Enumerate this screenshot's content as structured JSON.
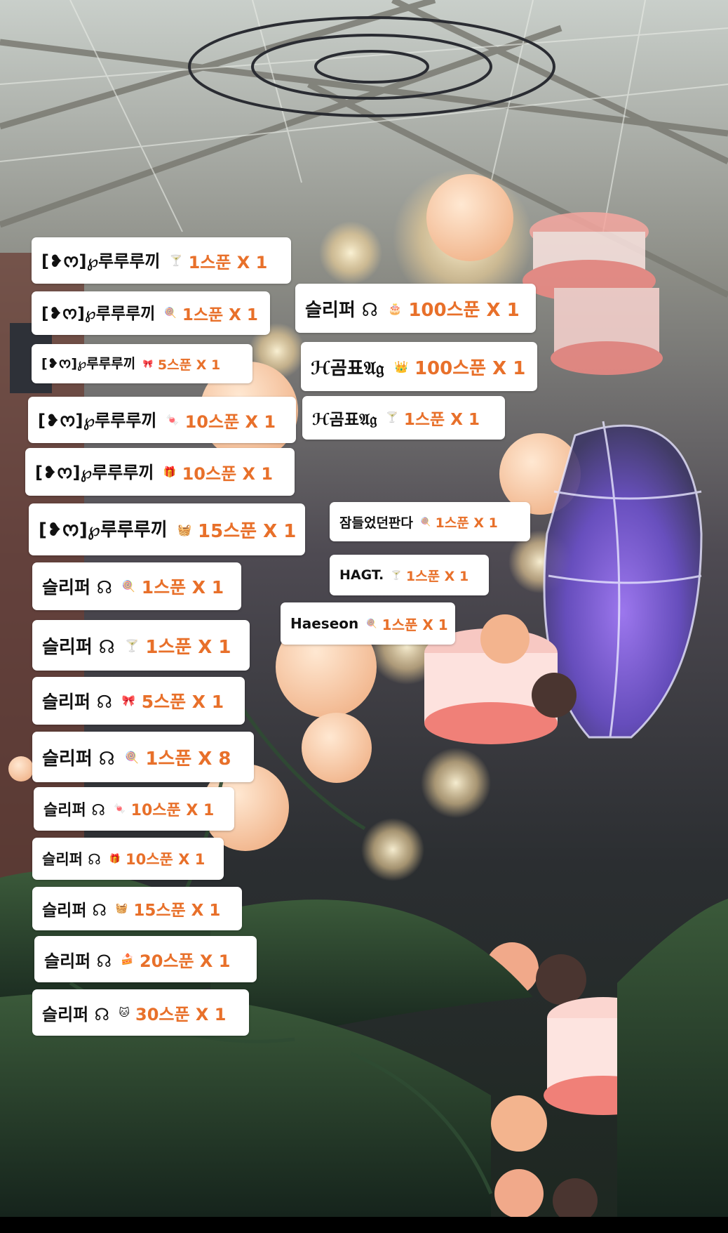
{
  "colors": {
    "amount": "#e8702a",
    "sticker_bg": "#ffffff",
    "name": "#111111"
  },
  "donations": [
    {
      "name": "[❥ᰔ]℘루루루끼",
      "icon": "🍸",
      "amount": "1스푼 X 1"
    },
    {
      "name": "[❥ᰔ]℘루루루끼",
      "icon": "🍭",
      "amount": "1스푼 X 1"
    },
    {
      "name": "[❥ᰔ]℘루루루끼",
      "icon": "🎀",
      "amount": "5스푼 X 1"
    },
    {
      "name": "[❥ᰔ]℘루루루끼",
      "icon": "🍬",
      "amount": "10스푼 X 1"
    },
    {
      "name": "[❥ᰔ]℘루루루끼",
      "icon": "🎁",
      "amount": "10스푼 X 1"
    },
    {
      "name": "[❥ᰔ]℘루루루끼",
      "icon": "🧺",
      "amount": "15스푼 X 1"
    },
    {
      "name": "슬리퍼 ☊",
      "icon": "🍭",
      "amount": "1스푼 X 1"
    },
    {
      "name": "슬리퍼 ☊",
      "icon": "🍸",
      "amount": "1스푼 X 1"
    },
    {
      "name": "슬리퍼 ☊",
      "icon": "🎀",
      "amount": "5스푼 X 1"
    },
    {
      "name": "슬리퍼 ☊",
      "icon": "🍭",
      "amount": "1스푼 X 8"
    },
    {
      "name": "슬리퍼 ☊",
      "icon": "🍬",
      "amount": "10스푼 X 1"
    },
    {
      "name": "슬리퍼 ☊",
      "icon": "🎁",
      "amount": "10스푼 X 1"
    },
    {
      "name": "슬리퍼 ☊",
      "icon": "🧺",
      "amount": "15스푼 X 1"
    },
    {
      "name": "슬리퍼 ☊",
      "icon": "🍰",
      "amount": "20스푼 X 1"
    },
    {
      "name": "슬리퍼 ☊",
      "icon": "🐱",
      "amount": "30스푼 X 1"
    },
    {
      "name": "슬리퍼 ☊",
      "icon": "🎂",
      "amount": "100스푼 X 1"
    },
    {
      "name": "ℋ곰표𝔄𝔤",
      "icon": "👑",
      "amount": "100스푼 X 1"
    },
    {
      "name": "ℋ곰표𝔄𝔤",
      "icon": "🍸",
      "amount": "1스푼 X 1"
    },
    {
      "name": "잠들었던판다",
      "icon": "🍭",
      "amount": "1스푼 X 1"
    },
    {
      "name": "HAGT.",
      "icon": "🍸",
      "amount": "1스푼 X 1"
    },
    {
      "name": "Haeseon",
      "icon": "🍭",
      "amount": "1스푼 X 1"
    }
  ]
}
